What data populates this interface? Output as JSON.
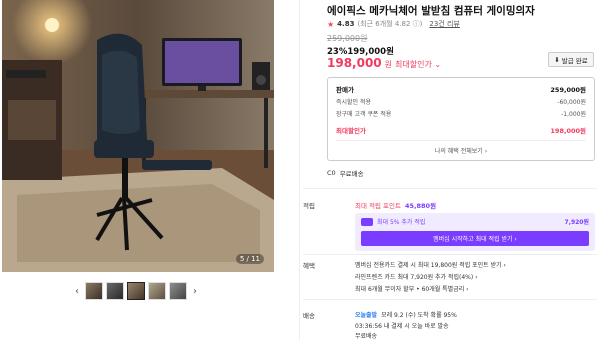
{
  "product": {
    "title": "에이픽스 메카닉체어 발받침 컴퓨터 게이밍의자",
    "rating": "4.83",
    "rating_meta": "(최근 6개월 4.82 ⓘ)",
    "review_link": "23건 리뷰"
  },
  "gallery": {
    "counter": "5 / 11",
    "thumb_icons": [
      "chevron-left-icon",
      "chevron-right-icon"
    ]
  },
  "price": {
    "original": "259,000원",
    "discount_rate": "23%",
    "discounted": "199,000원",
    "sale_price": "198,000",
    "sale_unit": "원",
    "sale_label": "최대할인가 ⌄",
    "coupon_button": "발급 완료"
  },
  "price_box": {
    "rows": [
      {
        "label": "판매가",
        "value": "259,000원"
      },
      {
        "label": "즉시할인 적용",
        "value": "-60,000원"
      },
      {
        "label": "장구매 고객 쿠폰 적용",
        "value": "-1,000원"
      },
      {
        "label": "최대할인가",
        "value": "198,000원"
      }
    ],
    "more_link": "나의 혜택 전체보기 ›"
  },
  "shipping": {
    "icon_text": "Ⅽ0",
    "label": "무료배송"
  },
  "points": {
    "label": "적립",
    "top_text": "최대 적립 포인트",
    "top_value": "45,880원",
    "membership_text": "최대 5% 추가 적립",
    "membership_amount": "7,920원",
    "membership_button": "멤버십 시작하고 최대 적립 받기 ›"
  },
  "benefit": {
    "label": "혜택",
    "lines": [
      "멤버십 전용카드 결제 시 최대 19,800원 적립 포인트 받기 ›",
      "라인프렌즈 카드 최대 7,920원 추가 적립(4%) ›",
      "최대 6개월 무이자 할부 • 60개월 특별금리 ›"
    ]
  },
  "delivery": {
    "label": "배송",
    "today": "오늘출발",
    "line1": "모레 9.2 (수) 도착 확률 95%",
    "line2": "03:36:56 내 결제 시 오늘 바로 발송",
    "line3": "무료배송"
  }
}
